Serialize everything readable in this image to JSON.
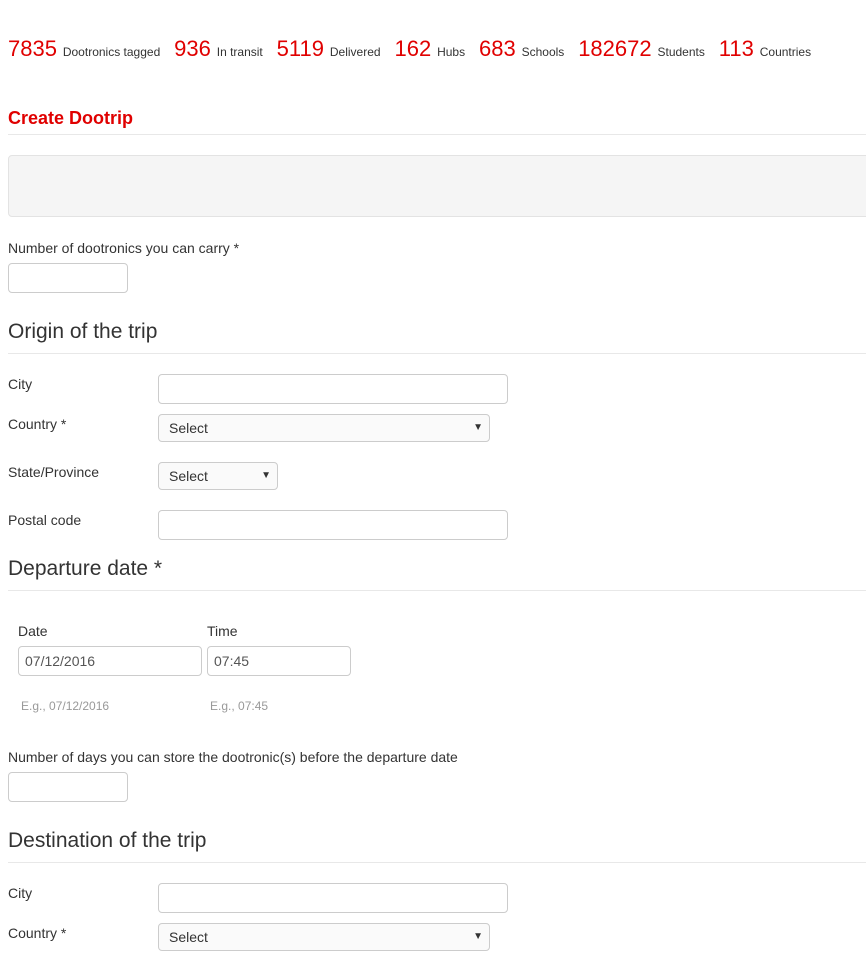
{
  "stats": [
    {
      "value": "7835",
      "label": "Dootronics tagged"
    },
    {
      "value": "936",
      "label": "In transit"
    },
    {
      "value": "5119",
      "label": "Delivered"
    },
    {
      "value": "162",
      "label": "Hubs"
    },
    {
      "value": "683",
      "label": "Schools"
    },
    {
      "value": "182672",
      "label": "Students"
    },
    {
      "value": "113",
      "label": "Countries"
    }
  ],
  "form": {
    "title": "Create Dootrip",
    "carry_label": "Number of dootronics you can carry *",
    "carry_value": "",
    "origin": {
      "title": "Origin of the trip",
      "city_label": "City",
      "city_value": "",
      "country_label": "Country *",
      "country_value": "Select",
      "state_label": "State/Province",
      "state_value": "Select",
      "postal_label": "Postal code",
      "postal_value": ""
    },
    "departure": {
      "title": "Departure date *",
      "date_label": "Date",
      "date_value": "07/12/2016",
      "date_hint": "E.g., 07/12/2016",
      "time_label": "Time",
      "time_value": "07:45",
      "time_hint": "E.g., 07:45"
    },
    "store_label": "Number of days you can store the dootronic(s) before the departure date",
    "store_value": "",
    "destination": {
      "title": "Destination of the trip",
      "city_label": "City",
      "city_value": "",
      "country_label": "Country *",
      "country_value": "Select"
    }
  },
  "colors": {
    "accent": "#e00000"
  }
}
